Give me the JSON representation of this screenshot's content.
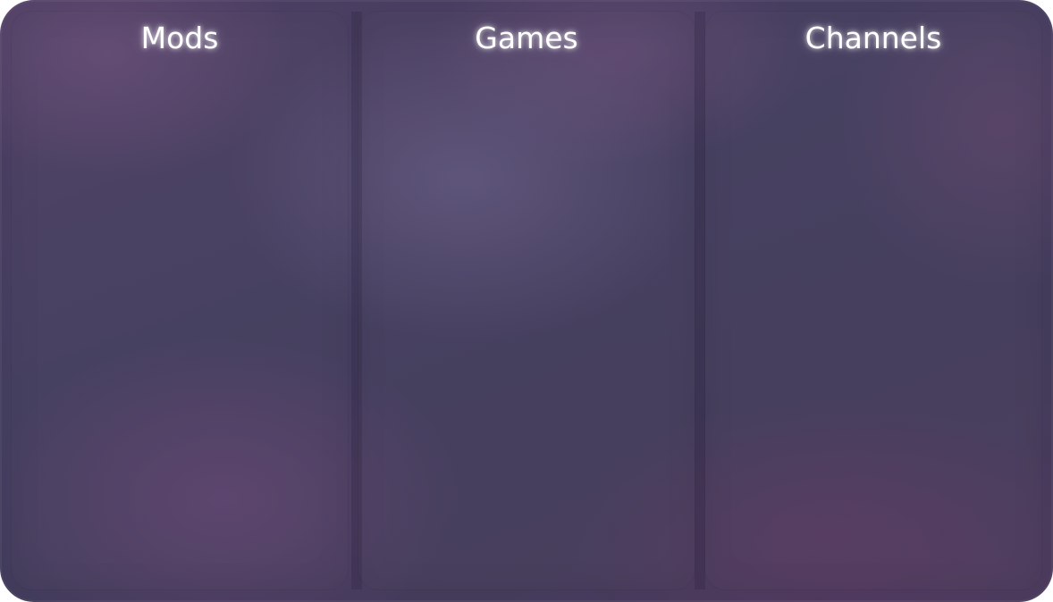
{
  "panels": [
    {
      "id": "mods",
      "title": "Mods"
    },
    {
      "id": "games",
      "title": "Games"
    },
    {
      "id": "channels",
      "title": "Channels"
    }
  ],
  "colors": {
    "background_base": "#433d5e",
    "background_accent": "#6e4678",
    "title_text": "#ffffff"
  }
}
